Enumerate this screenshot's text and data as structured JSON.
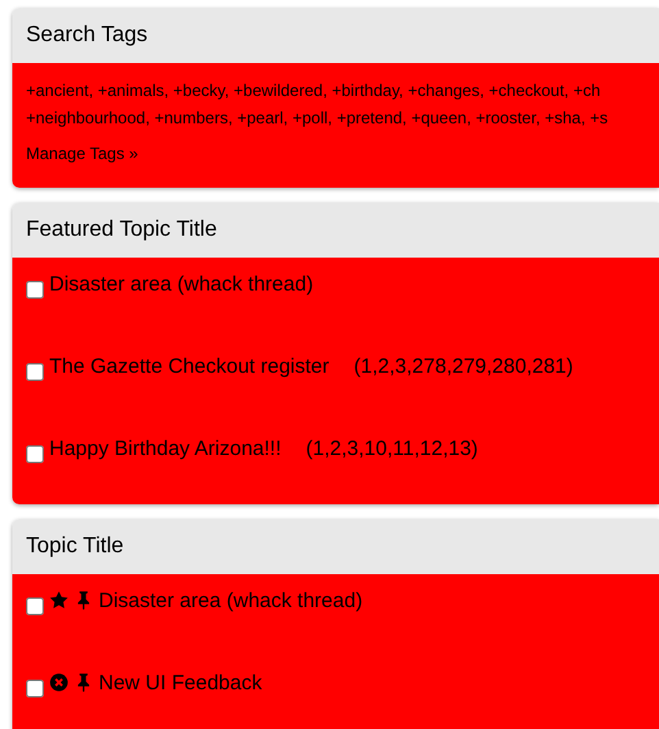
{
  "search_tags": {
    "title": "Search Tags",
    "tag_lines": [
      "+ancient, +animals, +becky, +bewildered, +birthday, +changes, +checkout, +ch",
      "+neighbourhood, +numbers, +pearl, +poll, +pretend, +queen, +rooster, +sha, +s"
    ],
    "manage_link": "Manage Tags »"
  },
  "panels": [
    {
      "title": "Featured Topic Title",
      "topics": [
        {
          "title": "Disaster area (whack thread)",
          "checked": false,
          "starred": false,
          "closed": false,
          "pinned": false
        },
        {
          "title": "The Gazette Checkout register",
          "pages": "(1,2,3,278,279,280,281)",
          "checked": false,
          "starred": false,
          "closed": false,
          "pinned": false
        },
        {
          "title": "Happy Birthday Arizona!!!",
          "pages": "(1,2,3,10,11,12,13)",
          "checked": false,
          "starred": false,
          "closed": false,
          "pinned": false
        }
      ]
    },
    {
      "title": "Topic Title",
      "topics": [
        {
          "title": "Disaster area (whack thread)",
          "checked": false,
          "starred": true,
          "closed": false,
          "pinned": true
        },
        {
          "title": "New UI Feedback",
          "checked": false,
          "starred": false,
          "closed": true,
          "pinned": true
        }
      ]
    }
  ]
}
